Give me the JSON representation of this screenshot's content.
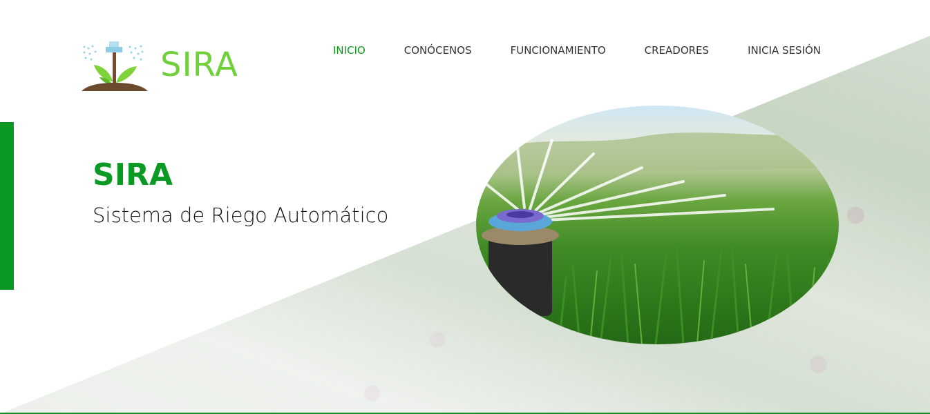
{
  "brand": {
    "name": "SIRA"
  },
  "nav": {
    "items": [
      {
        "label": "INICIO",
        "active": true
      },
      {
        "label": "CONÓCENOS",
        "active": false
      },
      {
        "label": "FUNCIONAMIENTO",
        "active": false
      },
      {
        "label": "CREADORES",
        "active": false
      },
      {
        "label": "INICIA SESIÓN",
        "active": false
      }
    ]
  },
  "hero": {
    "title": "SIRA",
    "subtitle": "Sistema de Riego Automático"
  },
  "colors": {
    "primary_green": "#0a9a24",
    "logo_green": "#6fd13a",
    "nav_active": "#0d9b1a",
    "text_dark": "#333333"
  },
  "images": {
    "logo": "sprinkler-plant-logo",
    "hero_image": "lawn-sprinkler-photo",
    "background": "plants-with-water-drops"
  }
}
